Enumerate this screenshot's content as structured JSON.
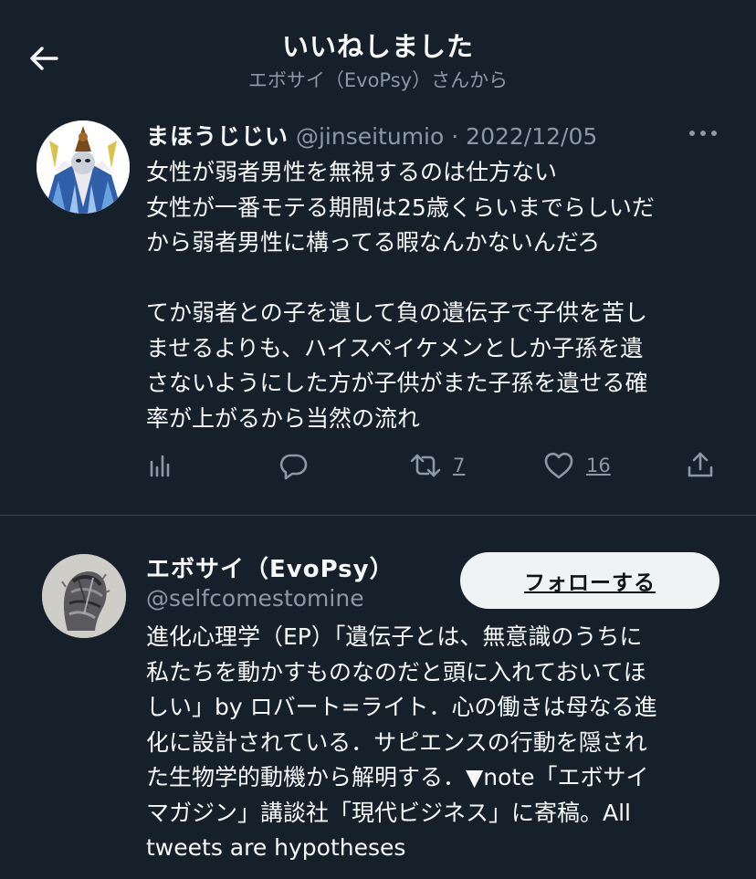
{
  "header": {
    "title": "いいねしました",
    "subtitle": "エボサイ（EvoPsy）さんから",
    "back_icon": "arrow-left-icon"
  },
  "tweet": {
    "author_name": "まほうじじい",
    "handle": "@jinseitumio",
    "separator": "·",
    "date": "2022/12/05",
    "more_icon": "more-dots-icon",
    "body_lines_1": [
      "女性が弱者男性を無視するのは仕方ない",
      "女性が一番モテる期間は25歳くらいまでらしいだ",
      "から弱者男性に構ってる暇なんかないんだろ"
    ],
    "body_lines_2": [
      "てか弱者との子を遺して負の遺伝子で子供を苦し",
      "ませるよりも、ハイスペイケメンとしか子孫を遺",
      "さないようにした方が子供がまた子孫を遺せる確",
      "率が上がるから当然の流れ"
    ],
    "actions": {
      "views_icon": "analytics-icon",
      "reply_icon": "reply-icon",
      "retweet_icon": "retweet-icon",
      "retweet_count": "7",
      "like_icon": "heart-icon",
      "like_count": "16",
      "share_icon": "share-icon"
    }
  },
  "user": {
    "name": "エボサイ（EvoPsy）",
    "handle": "@selfcomestomine",
    "follow_label": "フォローする",
    "bio_lines": [
      "進化心理学（EP）「遺伝子とは、無意識のうちに",
      "私たちを動かすものなのだと頭に入れておいてほ",
      "しい」by ロバート=ライト．心の働きは母なる進",
      "化に設計されている．サピエンスの行動を隠され",
      "た生物学的動機から解明する．▼note「エボサイ",
      "マガジン」講談社「現代ビジネス」に寄稿。All",
      "tweets are hypotheses"
    ]
  },
  "colors": {
    "background": "#15202b",
    "text_primary": "#f7f9f9",
    "text_secondary": "#8b98a5",
    "divider": "#38444d",
    "follow_button_bg": "#eff3f4"
  }
}
